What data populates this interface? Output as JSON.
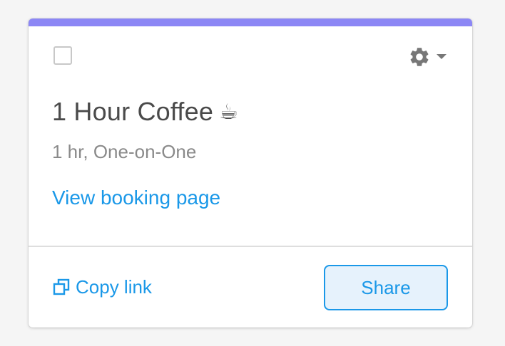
{
  "event_card": {
    "accent_color": "#8c87f5",
    "title": "1 Hour Coffee",
    "title_emoji": "☕",
    "subtitle": "1 hr, One-on-One",
    "view_link_label": "View booking page",
    "copy_link_label": "Copy link",
    "share_label": "Share",
    "link_color": "#1a98e8",
    "icons": {
      "settings": "gear-icon",
      "dropdown": "caret-down-icon",
      "copy": "copy-icon"
    }
  }
}
